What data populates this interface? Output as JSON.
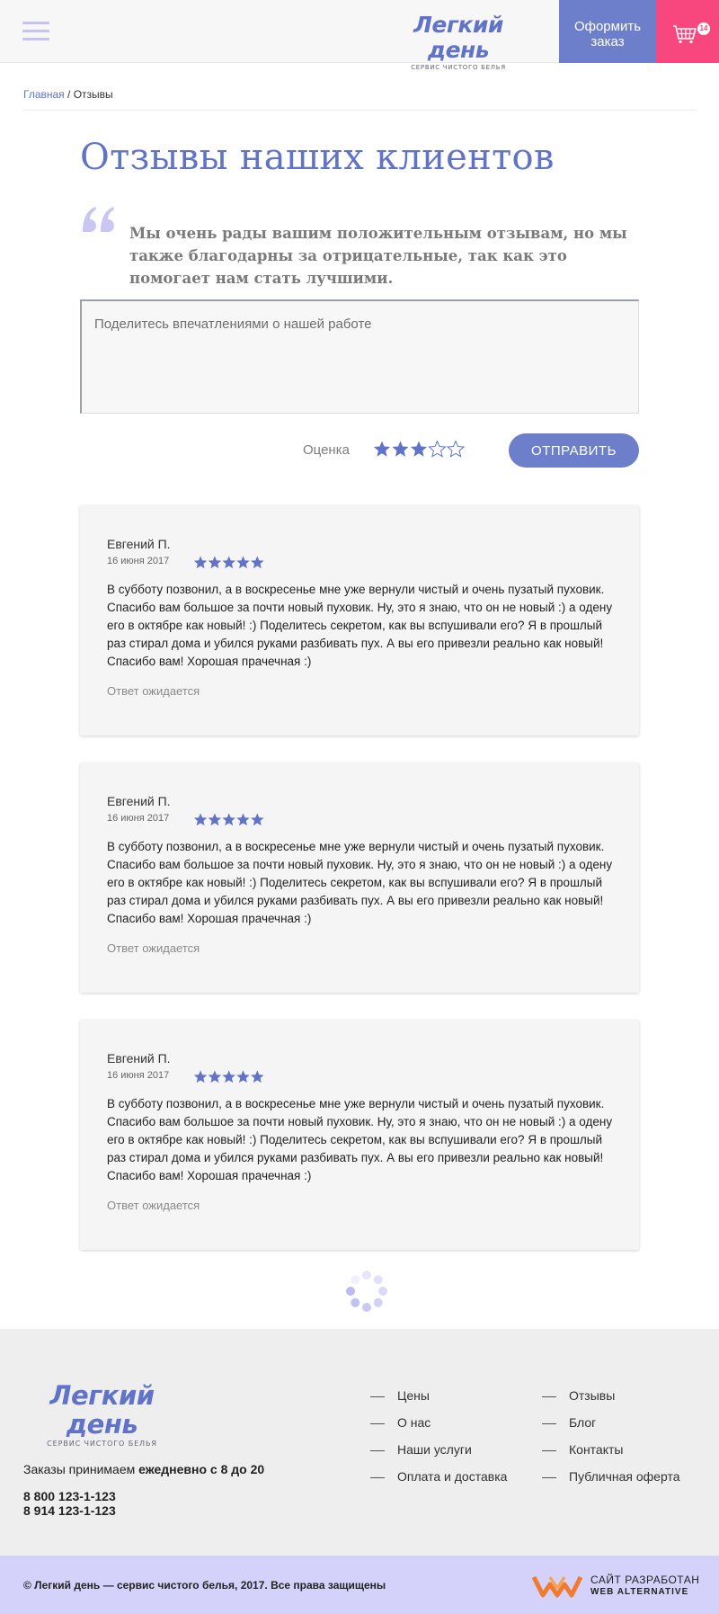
{
  "colors": {
    "accent": "#6173c7",
    "button": "#6d7fcb",
    "cart": "#f8467f",
    "star": "#6173c7",
    "bottom_bar": "#d4d2fa"
  },
  "header": {
    "menu_icon": "hamburger-icon",
    "logo": {
      "title": "Легкий день",
      "subtitle": "СЕРВИС ЧИСТОГО БЕЛЬЯ"
    },
    "order_button": {
      "line1": "Оформить",
      "line2": "заказ"
    },
    "cart": {
      "icon": "basket-icon",
      "count": "14"
    }
  },
  "breadcrumb": {
    "home": "Главная",
    "separator": " / ",
    "current": "Отзывы"
  },
  "page_title": "Отзывы наших клиентов",
  "intro_quote": "Мы очень рады вашим положительным отзывам, но мы также благодарны за отрицательные, так как это помогает нам стать лучшими.",
  "review_form": {
    "placeholder": "Поделитесь впечатлениями о нашей работе",
    "rating_label": "Оценка",
    "rating_value": 3,
    "rating_max": 5,
    "submit_label": "ОТПРАВИТЬ"
  },
  "reviews": [
    {
      "author": "Евгений П.",
      "date": "16 июня 2017",
      "rating": 5,
      "text": "В субботу позвонил, а в воскресенье мне уже вернули чистый и очень пузатый пуховик. Спасибо вам большое за почти новый пуховик. Ну, это я знаю, что он не новый :) а одену его в октябре как новый! :) Поделитесь секретом, как вы вспушивали его? Я в прошлый раз стирал дома и убился руками разбивать пух. А вы его привезли реально как новый! Спасибо вам! Хорошая прачечная :)",
      "status": "Ответ ожидается"
    },
    {
      "author": "Евгений П.",
      "date": "16 июня 2017",
      "rating": 5,
      "text": "В субботу позвонил, а в воскресенье мне уже вернули чистый и очень пузатый пуховик. Спасибо вам большое за почти новый пуховик. Ну, это я знаю, что он не новый :) а одену его в октябре как новый! :) Поделитесь секретом, как вы вспушивали его? Я в прошлый раз стирал дома и убился руками разбивать пух. А вы его привезли реально как новый! Спасибо вам! Хорошая прачечная :)",
      "status": "Ответ ожидается"
    },
    {
      "author": "Евгений П.",
      "date": "16 июня 2017",
      "rating": 5,
      "text": "В субботу позвонил, а в воскресенье мне уже вернули чистый и очень пузатый пуховик. Спасибо вам большое за почти новый пуховик. Ну, это я знаю, что он не новый :) а одену его в октябре как новый! :) Поделитесь секретом, как вы вспушивали его? Я в прошлый раз стирал дома и убился руками разбивать пух. А вы его привезли реально как новый! Спасибо вам! Хорошая прачечная :)",
      "status": "Ответ ожидается"
    }
  ],
  "footer": {
    "logo": {
      "title": "Легкий день",
      "subtitle": "СЕРВИС ЧИСТОГО БЕЛЬЯ"
    },
    "orders_prefix": "Заказы  принимаем ",
    "orders_hours": "ежедневно с 8 до 20",
    "phones": [
      "8 800 123-1-123",
      "8 914  123-1-123"
    ],
    "nav_col1": [
      "Цены",
      "О нас",
      "Наши услуги",
      "Оплата и доставка"
    ],
    "nav_col2": [
      "Отзывы",
      "Блог",
      "Контакты",
      "Публичная оферта"
    ],
    "copyright": "© Легкий день — сервис чистого белья, 2017. Все права защищены",
    "developer": {
      "line1": "САЙТ РАЗРАБОТАН",
      "line2": "WEB ALTERNATIVE",
      "icon": "web-alternative-logo-icon"
    }
  }
}
